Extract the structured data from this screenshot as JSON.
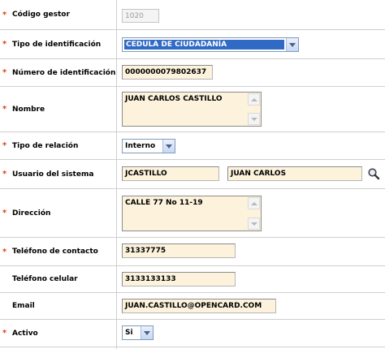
{
  "fields": {
    "codigo_gestor": {
      "label": "Código gestor",
      "value": "1020"
    },
    "tipo_identificacion": {
      "label": "Tipo de identificación",
      "value": "CEDULA DE CIUDADANÍA"
    },
    "numero_identificacion": {
      "label": "Número de identificación",
      "value": "0000000079802637"
    },
    "nombre": {
      "label": "Nombre",
      "value": "JUAN CARLOS CASTILLO"
    },
    "tipo_relacion": {
      "label": "Tipo de relación",
      "value": "Interno"
    },
    "usuario_sistema": {
      "label": "Usuario del sistema",
      "login": "JCASTILLO",
      "name": "JUAN CARLOS"
    },
    "direccion": {
      "label": "Dirección",
      "value": "CALLE 77 No 11-19"
    },
    "telefono_contacto": {
      "label": "Teléfono de contacto",
      "value": "31337775"
    },
    "telefono_celular": {
      "label": "Teléfono celular",
      "value": "3133133133"
    },
    "email": {
      "label": "Email",
      "value": "JUAN.CASTILLO@OPENCARD.COM"
    },
    "activo": {
      "label": "Activo",
      "value": "Si"
    }
  },
  "required_marker": "*",
  "icons": {
    "search": "magnifier-icon"
  },
  "colors": {
    "required": "#d9430e",
    "input_bg": "#fdf3dc",
    "select_highlight": "#316ac5"
  }
}
